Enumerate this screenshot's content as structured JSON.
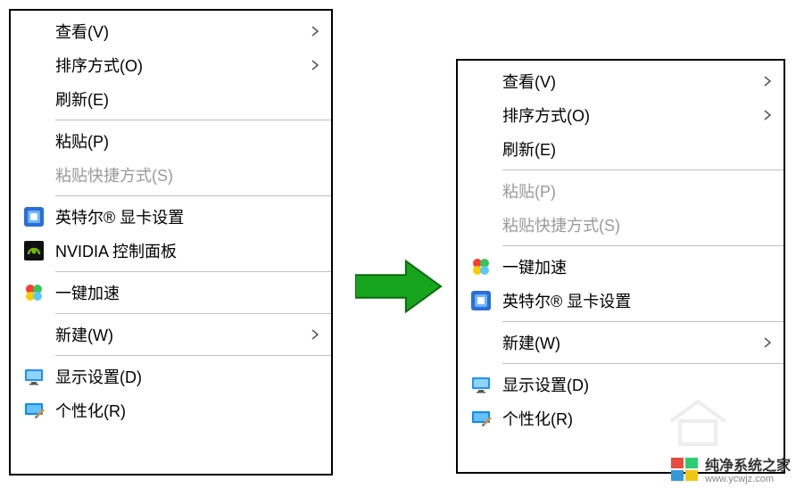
{
  "left_menu": {
    "view": "查看(V)",
    "sort": "排序方式(O)",
    "refresh": "刷新(E)",
    "paste": "粘贴(P)",
    "paste_shortcut": "粘贴快捷方式(S)",
    "intel_gfx": "英特尔®  显卡设置",
    "nvidia_cp": "NVIDIA 控制面板",
    "one_click": "一键加速",
    "new": "新建(W)",
    "display_settings": "显示设置(D)",
    "personalize": "个性化(R)"
  },
  "right_menu": {
    "view": "查看(V)",
    "sort": "排序方式(O)",
    "refresh": "刷新(E)",
    "paste": "粘贴(P)",
    "paste_shortcut": "粘贴快捷方式(S)",
    "one_click": "一键加速",
    "intel_gfx": "英特尔®  显卡设置",
    "new": "新建(W)",
    "display_settings": "显示设置(D)",
    "personalize": "个性化(R)"
  },
  "watermark": {
    "title": "纯净系统之家",
    "url": "www.ycwjz.com"
  },
  "icons": {
    "intel": "intel-graphics-icon",
    "nvidia": "nvidia-icon",
    "oneclick": "accelerate-icon",
    "display": "display-icon",
    "personalize": "personalize-icon"
  }
}
